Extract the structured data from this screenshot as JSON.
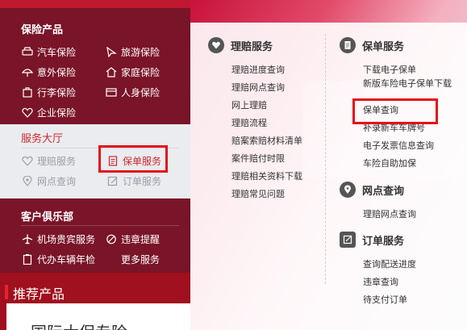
{
  "insurance_products": {
    "title": "保险产品",
    "items": [
      {
        "label": "汽车保险",
        "icon": "car-icon"
      },
      {
        "label": "旅游保险",
        "icon": "plane-icon"
      },
      {
        "label": "意外保险",
        "icon": "umbrella-icon"
      },
      {
        "label": "家庭保险",
        "icon": "home-icon"
      },
      {
        "label": "行李保险",
        "icon": "luggage-icon"
      },
      {
        "label": "人身保险",
        "icon": "card-icon"
      },
      {
        "label": "企业保险",
        "icon": "heart-icon"
      }
    ]
  },
  "service_hall": {
    "title": "服务大厅",
    "items": [
      {
        "label": "理赔服务",
        "icon": "shield-icon"
      },
      {
        "label": "保单服务",
        "icon": "document-icon"
      },
      {
        "label": "网点查询",
        "icon": "location-icon"
      },
      {
        "label": "订单服务",
        "icon": "edit-icon"
      }
    ]
  },
  "club": {
    "title": "客户俱乐部",
    "items": [
      {
        "label": "机场贵宾服务",
        "icon": "airplane-icon"
      },
      {
        "label": "违章提醒",
        "icon": "forbidden-icon"
      },
      {
        "label": "代办车辆年检",
        "icon": "clipboard-icon"
      },
      {
        "label": "更多服务",
        "icon": ""
      }
    ]
  },
  "recommend": {
    "title": "推荐产品",
    "card_text": "国际大保专险"
  },
  "panel": {
    "claims": {
      "title": "理赔服务",
      "links": [
        "理赔进度查询",
        "理赔网点查询",
        "网上理赔",
        "理赔流程",
        "赔案索赔材料清单",
        "案件赔付时限",
        "理赔相关资料下载",
        "理赔常见问题"
      ]
    },
    "policy": {
      "title": "保单服务",
      "links": [
        "下载电子保单",
        "新版车险电子保单下载",
        "保单查询",
        "补录新车车牌号",
        "电子发票信息查询",
        "车险自助加保"
      ]
    },
    "outlets": {
      "title": "网点查询",
      "links": [
        "理赔网点查询"
      ]
    },
    "orders": {
      "title": "订单服务",
      "links": [
        "查询配送进度",
        "违章查询",
        "待支付订单"
      ]
    }
  },
  "colors": {
    "highlight": "#e3101c",
    "left_bg": "#7a1428",
    "service_active": "#d0272f"
  }
}
